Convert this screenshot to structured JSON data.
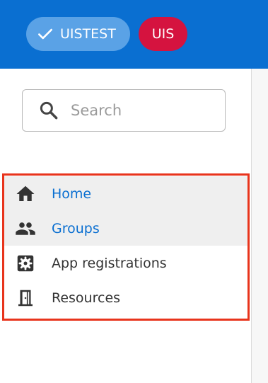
{
  "header": {
    "site_chip": {
      "label": "UISTEST",
      "icon": "check-icon",
      "color": "#5aa2e6"
    },
    "org_chip": {
      "label": "UIS",
      "color": "#d5133f"
    },
    "background": "#0a6fd1"
  },
  "search": {
    "placeholder": "Search",
    "value": "",
    "icon": "search-icon"
  },
  "nav": {
    "items": [
      {
        "label": "Home",
        "icon": "home-icon",
        "active": true
      },
      {
        "label": "Groups",
        "icon": "groups-icon",
        "active": true
      },
      {
        "label": "App registrations",
        "icon": "app-registrations-icon",
        "active": false
      },
      {
        "label": "Resources",
        "icon": "resources-icon",
        "active": false
      }
    ]
  },
  "colors": {
    "accent": "#0a6fd1",
    "highlight_border": "#e8341c",
    "active_row": "#efefef",
    "text": "#333333"
  }
}
